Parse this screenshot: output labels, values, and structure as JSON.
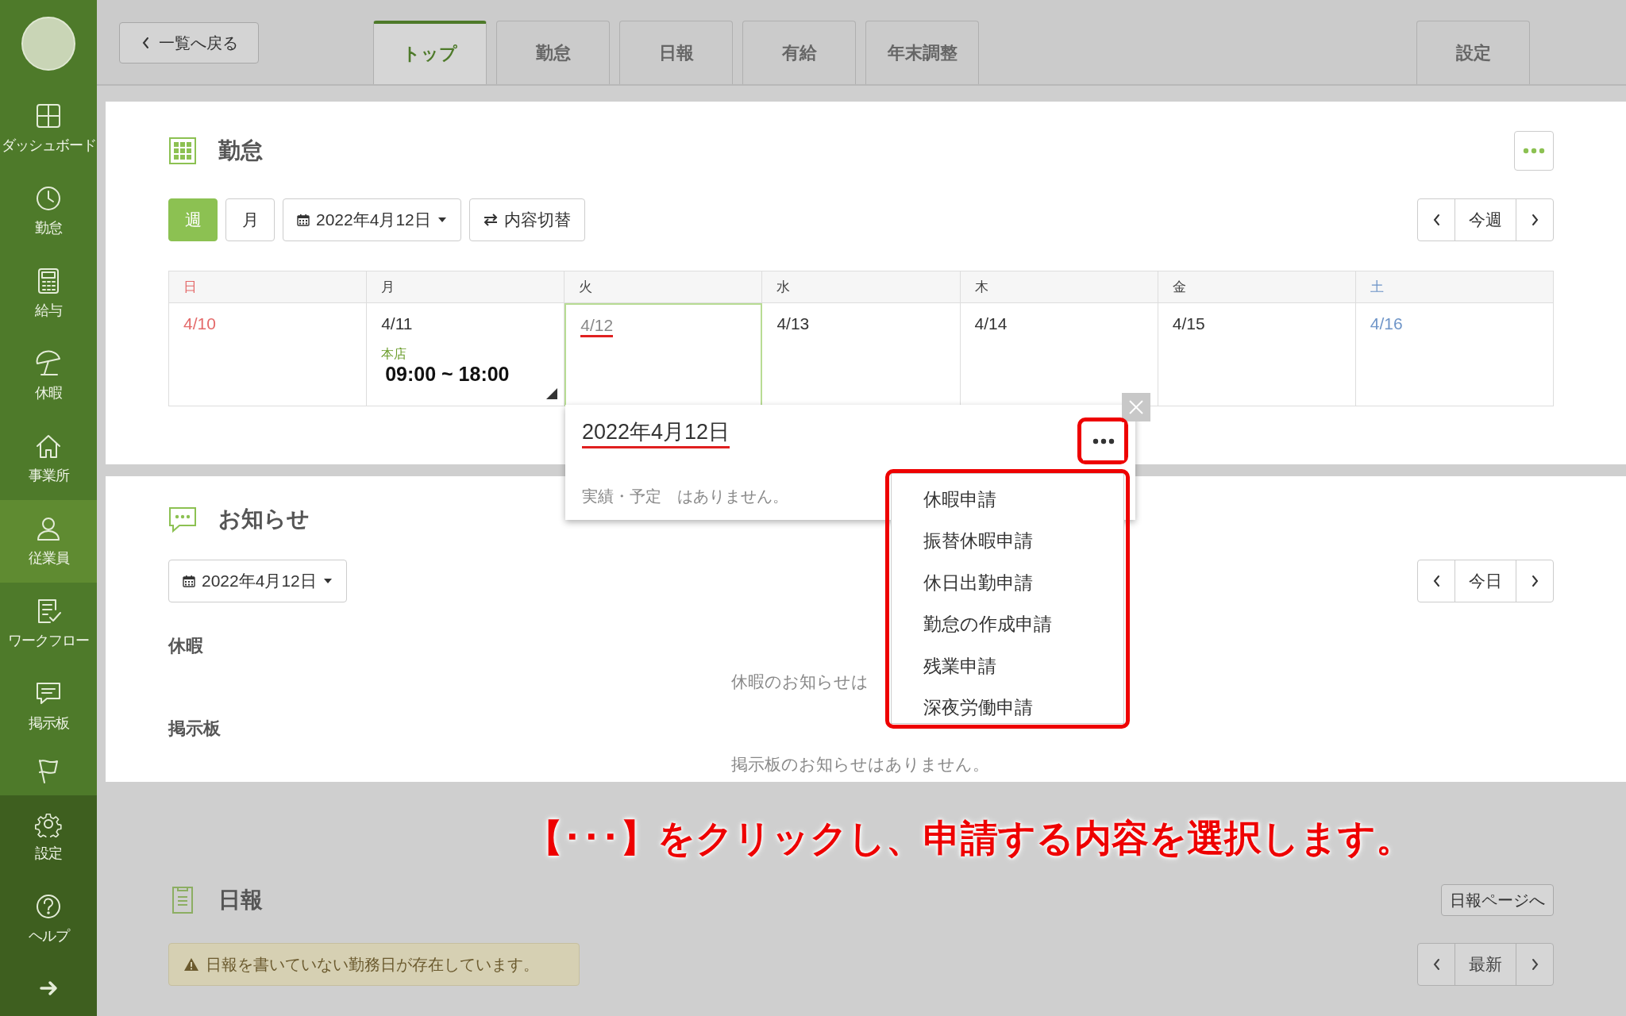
{
  "sidebar": {
    "items": [
      {
        "kind": "dashboard",
        "label": "ダッシュボード",
        "selected": false
      },
      {
        "kind": "clock",
        "label": "勤怠",
        "selected": false
      },
      {
        "kind": "calculator",
        "label": "給与",
        "selected": false
      },
      {
        "kind": "umbrella",
        "label": "休暇",
        "selected": false
      },
      {
        "kind": "home",
        "label": "事業所",
        "selected": false
      },
      {
        "kind": "person",
        "label": "従業員",
        "selected": true
      },
      {
        "kind": "checklist",
        "label": "ワークフロー",
        "selected": false
      },
      {
        "kind": "chat",
        "label": "掲示板",
        "selected": false
      },
      {
        "kind": "flag",
        "selected": false
      }
    ],
    "footer_items": [
      {
        "kind": "gear",
        "label": "設定"
      },
      {
        "kind": "help",
        "label": "ヘルプ"
      },
      {
        "kind": "arrow"
      }
    ]
  },
  "top_bar": {
    "back_button": "一覧へ戻る",
    "tabs": [
      {
        "label": "トップ",
        "selected": true
      },
      {
        "label": "勤怠",
        "selected": false
      },
      {
        "label": "日報",
        "selected": false
      },
      {
        "label": "有給",
        "selected": false
      },
      {
        "label": "年末調整",
        "selected": false
      }
    ],
    "settings_tab": "設定"
  },
  "attendance": {
    "title": "勤怠",
    "view_buttons": [
      {
        "label": "週",
        "selected": true
      },
      {
        "label": "月",
        "selected": false
      }
    ],
    "date": "2022年4月12日",
    "switch_button": "内容切替",
    "nav_label": "今週",
    "calendar": {
      "days": [
        {
          "label": "日",
          "kind": "sunday"
        },
        {
          "label": "月",
          "kind": "weekday"
        },
        {
          "label": "火",
          "kind": "weekday"
        },
        {
          "label": "水",
          "kind": "weekday"
        },
        {
          "label": "木",
          "kind": "weekday"
        },
        {
          "label": "金",
          "kind": "weekday"
        },
        {
          "label": "土",
          "kind": "saturday"
        }
      ],
      "cells": [
        {
          "date": "4/10",
          "kind": "sunday",
          "selected": false
        },
        {
          "date": "4/11",
          "kind": "weekday",
          "selected": false,
          "shift": {
            "place": "本店",
            "time": "09:00 ~ 18:00"
          }
        },
        {
          "date": "4/12",
          "kind": "weekday",
          "selected": true
        },
        {
          "date": "4/13",
          "kind": "weekday",
          "selected": false
        },
        {
          "date": "4/14",
          "kind": "weekday",
          "selected": false
        },
        {
          "date": "4/15",
          "kind": "weekday",
          "selected": false
        },
        {
          "date": "4/16",
          "kind": "saturday",
          "selected": false
        }
      ]
    }
  },
  "popup": {
    "date": "2022年4月12日",
    "message": "実績・予定　はありません。",
    "menu": [
      "休暇申請",
      "振替休暇申請",
      "休日出勤申請",
      "勤怠の作成申請",
      "残業申請",
      "深夜労働申請"
    ]
  },
  "notices": {
    "title": "お知らせ",
    "date": "2022年4月12日",
    "nav_label": "今日",
    "sections": [
      {
        "heading": "休暇",
        "empty_text": "休暇のお知らせは"
      },
      {
        "heading": "掲示板",
        "empty_text": "掲示板のお知らせはありません。"
      }
    ]
  },
  "caption": "【･･･】をクリックし、申請する内容を選択します。",
  "daily": {
    "title": "日報",
    "page_button": "日報ページへ",
    "warning": "日報を書いていない勤務日が存在しています。",
    "nav_label": "最新"
  }
}
